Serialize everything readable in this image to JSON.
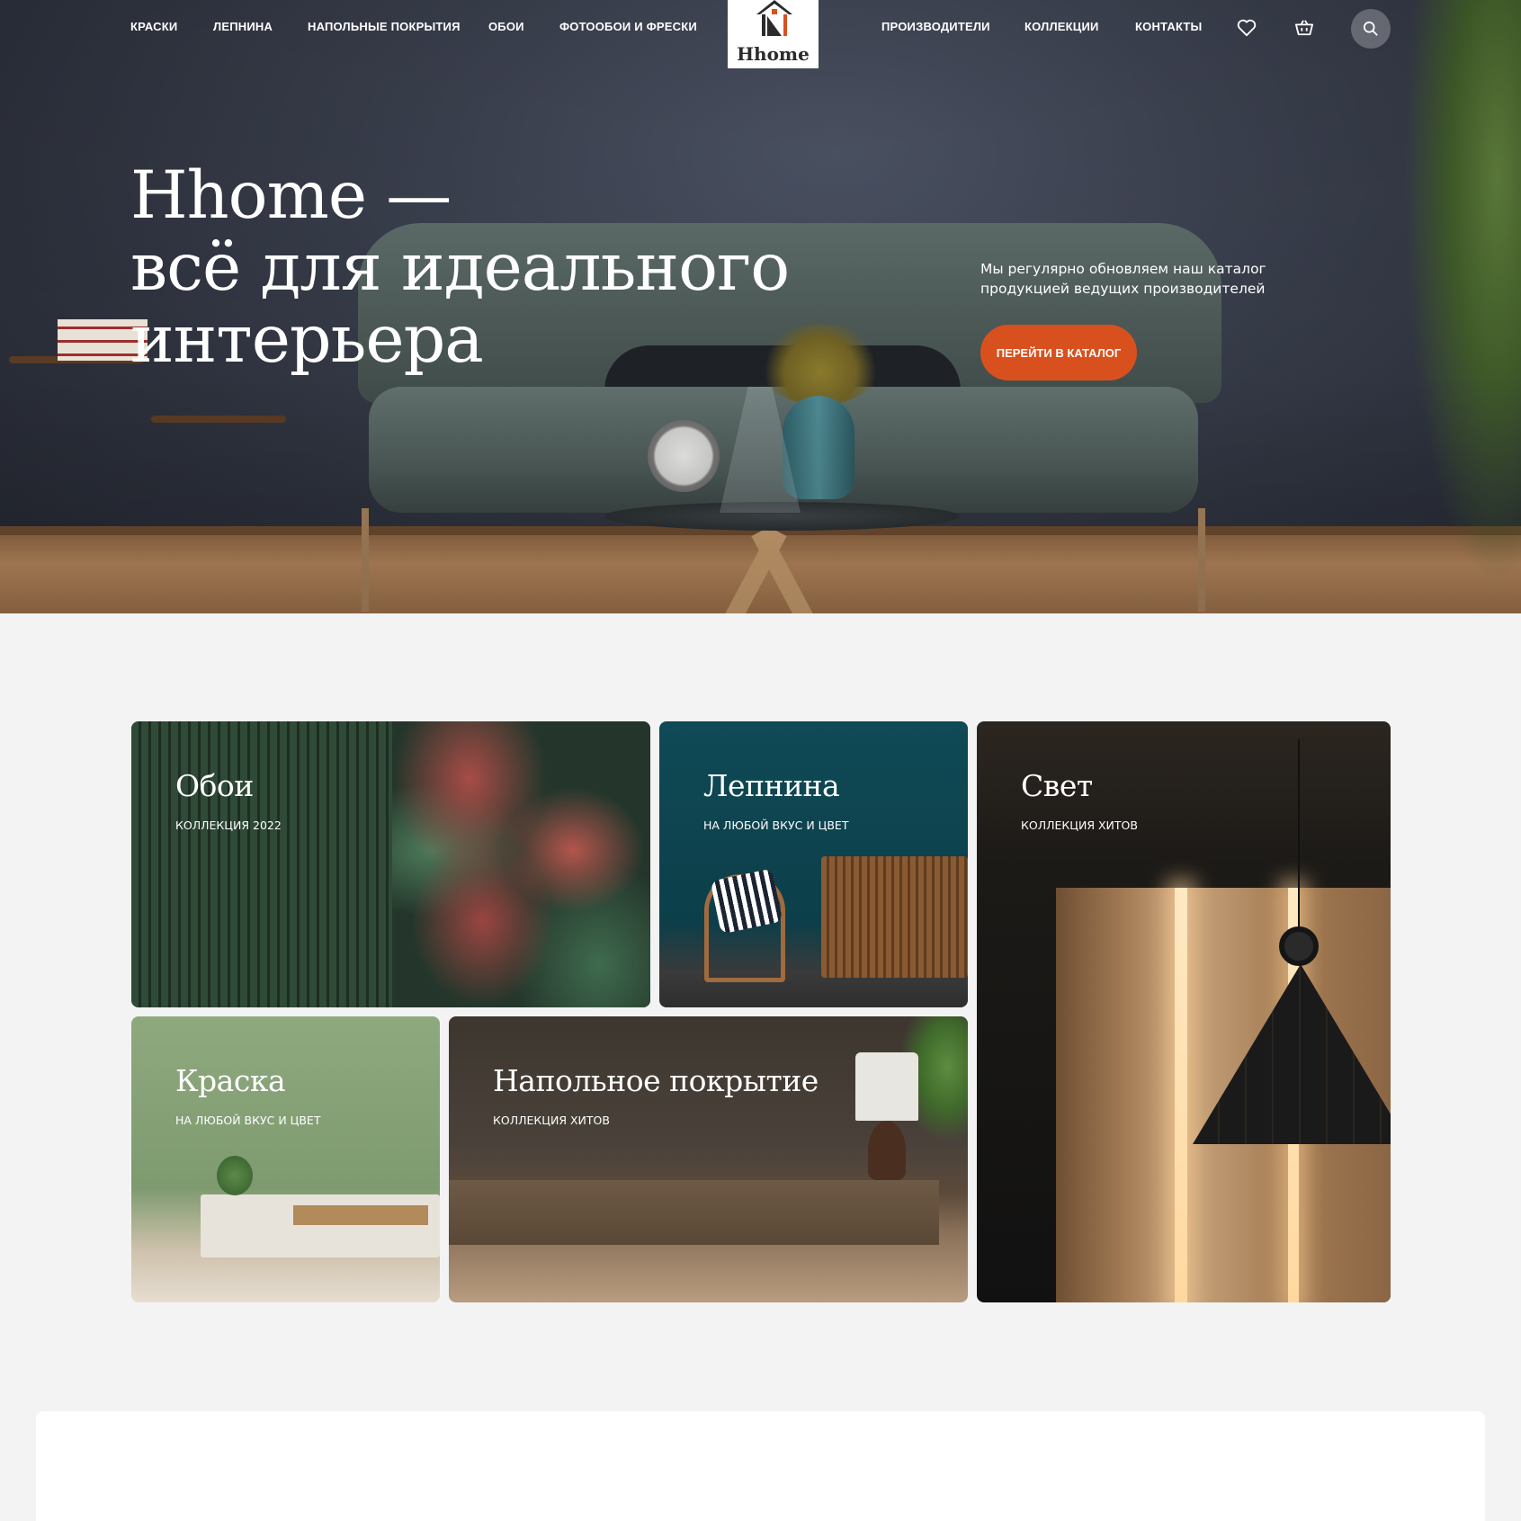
{
  "header": {
    "nav_left": [
      {
        "label": "КРАСКИ"
      },
      {
        "label": "ЛЕПНИНА"
      },
      {
        "label": "НАПОЛЬНЫЕ ПОКРЫТИЯ"
      },
      {
        "label": "ОБОИ"
      },
      {
        "label": "ФОТООБОИ И ФРЕСКИ"
      }
    ],
    "logo_text": "Hhome",
    "nav_right": [
      {
        "label": "ПРОИЗВОДИТЕЛИ"
      },
      {
        "label": "КОЛЛЕКЦИИ"
      },
      {
        "label": "КОНТАКТЫ"
      }
    ],
    "icons": {
      "favorites": "heart-icon",
      "cart": "basket-icon",
      "search": "search-icon"
    }
  },
  "hero": {
    "title_lines": [
      "Hhome —",
      "всё для идеального",
      "интерьера"
    ],
    "description": "Мы регулярно обновляем наш каталог продукцией ведущих производителей",
    "cta_label": "ПЕРЕЙТИ В КАТАЛОГ"
  },
  "categories": [
    {
      "title": "Обои",
      "subtitle": "КОЛЛЕКЦИЯ 2022"
    },
    {
      "title": "Лепнина",
      "subtitle": "НА ЛЮБОЙ ВКУС И ЦВЕТ"
    },
    {
      "title": "Свет",
      "subtitle": "КОЛЛЕКЦИЯ ХИТОВ"
    },
    {
      "title": "Краска",
      "subtitle": "НА ЛЮБОЙ ВКУС И ЦВЕТ"
    },
    {
      "title": "Напольное покрытие",
      "subtitle": "КОЛЛЕКЦИЯ ХИТОВ"
    }
  ],
  "colors": {
    "accent": "#d9501f",
    "page_background": "#f3f3f3",
    "header_text": "#ffffff"
  }
}
